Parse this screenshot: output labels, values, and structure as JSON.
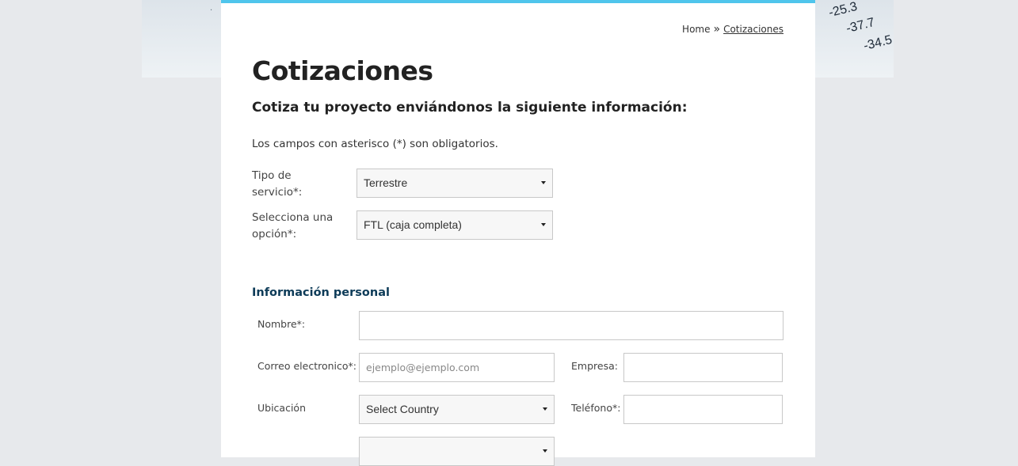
{
  "hero": {
    "numbers": [
      "-25.3",
      "-37.7",
      "-34.5"
    ]
  },
  "breadcrumb": {
    "home": "Home",
    "separator": "»",
    "current": "Cotizaciones"
  },
  "page": {
    "title": "Cotizaciones",
    "subtitle": "Cotiza tu proyecto enviándonos la siguiente información:",
    "required_note": "Los campos con asterisco (*) son obligatorios."
  },
  "service_form": {
    "service_type_label_line1": "Tipo de",
    "service_type_label_line2": "servicio*:",
    "service_type_value": "Terrestre",
    "option_label_line1": "Selecciona una",
    "option_label_line2": "opción*:",
    "option_value": "FTL (caja completa)"
  },
  "personal": {
    "section_title": "Información personal",
    "name_label": "Nombre*:",
    "email_label": "Correo electronico*:",
    "email_placeholder": "ejemplo@ejemplo.com",
    "company_label": "Empresa:",
    "location_label": "Ubicación",
    "country_value": "Select Country",
    "phone_label": "Teléfono*:",
    "state_value": ""
  },
  "colors": {
    "accent_bar": "#4fc5ec",
    "section_title": "#0d3b58",
    "background": "#e7e9ec"
  }
}
